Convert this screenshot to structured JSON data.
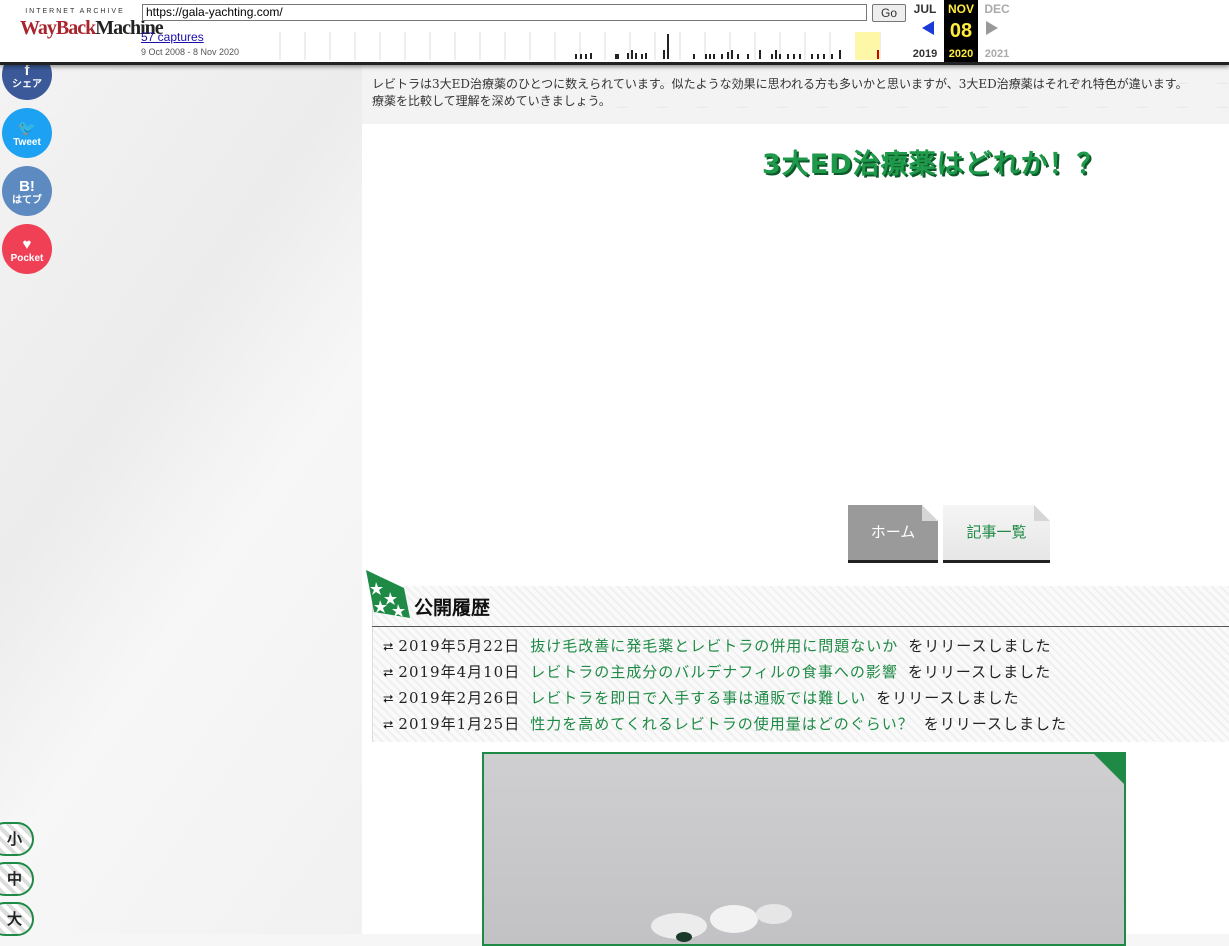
{
  "wayback": {
    "logo_top": "INTERNET ARCHIVE",
    "logo_main_1": "WayBack",
    "logo_main_2": "Machine",
    "url_value": "https://gala-yachting.com/",
    "go_label": "Go",
    "captures_label": "57 captures",
    "date_range": "9 Oct 2008 - 8 Nov 2020",
    "prev_month": "JUL",
    "prev_year": "2019",
    "cur_month": "NOV",
    "cur_day": "08",
    "cur_year": "2020",
    "next_month": "DEC",
    "next_year": "2021"
  },
  "share": [
    {
      "icon": "f",
      "label": "シェア",
      "color": "#3b5998"
    },
    {
      "icon": "🐦",
      "label": "Tweet",
      "color": "#1da1f2"
    },
    {
      "icon": "B!",
      "label": "はてブ",
      "color": "#5d8ac1"
    },
    {
      "icon": "♥",
      "label": "Pocket",
      "color": "#ef4056"
    }
  ],
  "intro_lines": [
    "レビトラは3大ED治療薬のひとつに数えられています。似たような効果に思われる方も多いかと思いますが、3大ED治療薬はそれぞれ特色が違います。",
    "療薬を比較して理解を深めていきましょう。"
  ],
  "headline": "3大ED治療薬はどれか！？",
  "nav": {
    "home": "ホーム",
    "list": "記事一覧"
  },
  "history": {
    "title": "公開履歴",
    "items": [
      {
        "date": "2019年5月22日",
        "link": "抜け毛改善に発毛薬とレビトラの併用に問題ないか",
        "suffix": "をリリースしました"
      },
      {
        "date": "2019年4月10日",
        "link": "レビトラの主成分のバルデナフィルの食事への影響",
        "suffix": "をリリースしました"
      },
      {
        "date": "2019年2月26日",
        "link": "レビトラを即日で入手する事は通販では難しい",
        "suffix": "をリリースしました"
      },
      {
        "date": "2019年1月25日",
        "link": "性力を高めてくれるレビトラの使用量はどのぐらい？",
        "suffix": "をリリースしました"
      }
    ]
  },
  "font_sizes": [
    "小",
    "中",
    "大"
  ],
  "colors": {
    "accent": "#1e8a45",
    "wayback_red": "#a9252e"
  }
}
